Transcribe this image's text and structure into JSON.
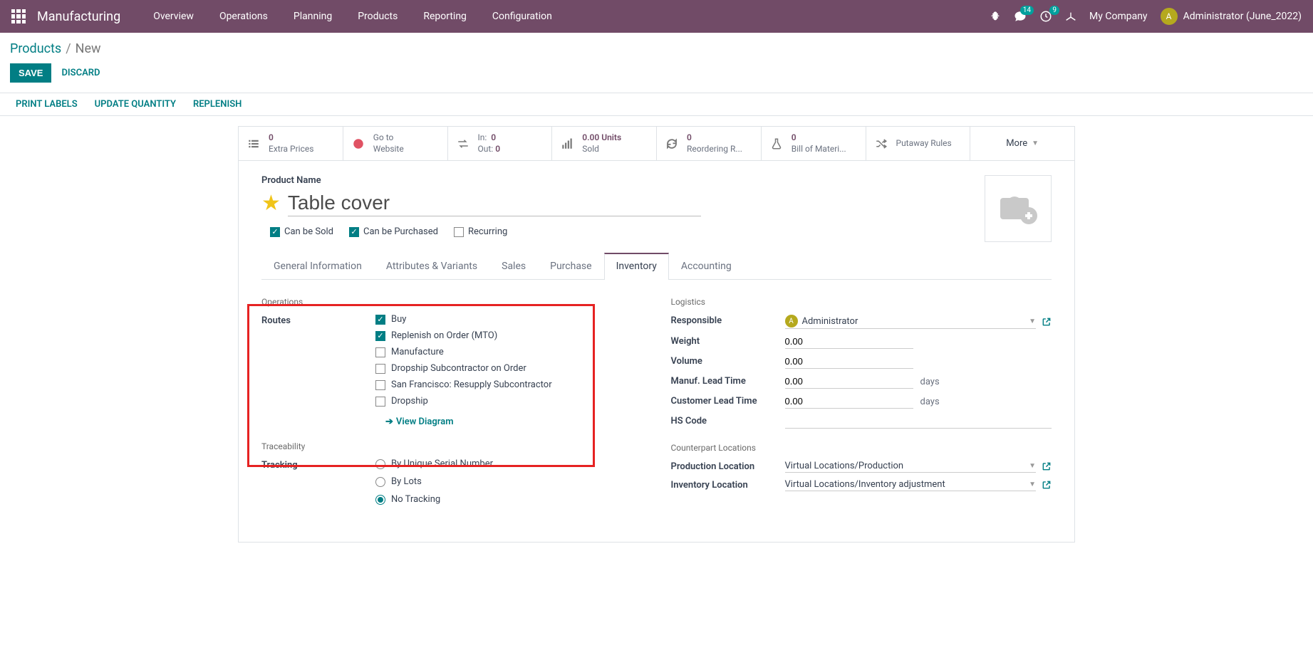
{
  "nav": {
    "brand": "Manufacturing",
    "items": [
      "Overview",
      "Operations",
      "Planning",
      "Products",
      "Reporting",
      "Configuration"
    ],
    "chat_count": "14",
    "clock_count": "9",
    "company": "My Company",
    "user_initial": "A",
    "user_name": "Administrator (June_2022)"
  },
  "breadcrumb": {
    "link": "Products",
    "current": "New"
  },
  "actions": {
    "save": "SAVE",
    "discard": "DISCARD"
  },
  "subactions": [
    "PRINT LABELS",
    "UPDATE QUANTITY",
    "REPLENISH"
  ],
  "stats": {
    "extra_prices": {
      "v": "0",
      "l": "Extra Prices"
    },
    "goto": {
      "l1": "Go to",
      "l2": "Website"
    },
    "inout": {
      "in_l": "In:",
      "in_v": "0",
      "out_l": "Out:",
      "out_v": "0"
    },
    "sold": {
      "v": "0.00 Units",
      "l": "Sold"
    },
    "reorder": {
      "v": "0",
      "l": "Reordering R..."
    },
    "bom": {
      "v": "0",
      "l": "Bill of Materi..."
    },
    "putaway": {
      "l": "Putaway Rules"
    },
    "more": "More"
  },
  "product": {
    "name_label": "Product Name",
    "name": "Table cover",
    "can_sold": "Can be Sold",
    "can_purchased": "Can be Purchased",
    "recurring": "Recurring"
  },
  "tabs": [
    "General Information",
    "Attributes & Variants",
    "Sales",
    "Purchase",
    "Inventory",
    "Accounting"
  ],
  "active_tab": 4,
  "inventory": {
    "operations_title": "Operations",
    "routes_label": "Routes",
    "routes": [
      {
        "label": "Buy",
        "checked": true
      },
      {
        "label": "Replenish on Order (MTO)",
        "checked": true
      },
      {
        "label": "Manufacture",
        "checked": false
      },
      {
        "label": "Dropship Subcontractor on Order",
        "checked": false
      },
      {
        "label": "San Francisco: Resupply Subcontractor",
        "checked": false
      },
      {
        "label": "Dropship",
        "checked": false
      }
    ],
    "view_diagram": "View Diagram",
    "traceability_title": "Traceability",
    "tracking_label": "Tracking",
    "tracking_options": [
      "By Unique Serial Number",
      "By Lots",
      "No Tracking"
    ],
    "tracking_selected": 2,
    "logistics_title": "Logistics",
    "responsible_label": "Responsible",
    "responsible_value": "Administrator",
    "responsible_initial": "A",
    "weight_label": "Weight",
    "weight_value": "0.00",
    "volume_label": "Volume",
    "volume_value": "0.00",
    "manuf_lead_label": "Manuf. Lead Time",
    "manuf_lead_value": "0.00",
    "cust_lead_label": "Customer Lead Time",
    "cust_lead_value": "0.00",
    "days_unit": "days",
    "hs_label": "HS Code",
    "counterpart_title": "Counterpart Locations",
    "prod_loc_label": "Production Location",
    "prod_loc_value": "Virtual Locations/Production",
    "inv_loc_label": "Inventory Location",
    "inv_loc_value": "Virtual Locations/Inventory adjustment"
  }
}
